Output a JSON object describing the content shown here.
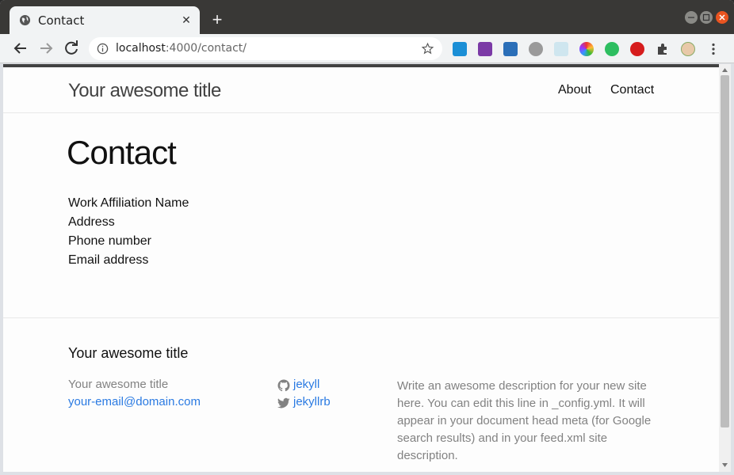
{
  "browser": {
    "tab_title": "Contact",
    "url_host": "localhost",
    "url_path": ":4000/contact/",
    "new_tab_label": "+",
    "tab_close_label": "✕"
  },
  "site": {
    "title": "Your awesome title",
    "nav": {
      "about": "About",
      "contact": "Contact"
    }
  },
  "main": {
    "heading": "Contact",
    "lines": [
      "Work Affiliation Name",
      "Address",
      "Phone number",
      "Email address"
    ]
  },
  "footer": {
    "heading": "Your awesome title",
    "name": "Your awesome title",
    "email": "your-email@domain.com",
    "github": "jekyll",
    "twitter": "jekyllrb",
    "description": "Write an awesome description for your new site here. You can edit this line in _config.yml. It will appear in your document head meta (for Google search results) and in your feed.xml site description."
  },
  "colors": {
    "link": "#2a7ae2",
    "muted": "#828282",
    "header_border": "#424242"
  },
  "icons": [
    "globe-icon",
    "back-icon",
    "forward-icon",
    "reload-icon",
    "info-icon",
    "star-icon",
    "github-icon",
    "twitter-icon",
    "puzzle-icon",
    "menu-icon"
  ]
}
